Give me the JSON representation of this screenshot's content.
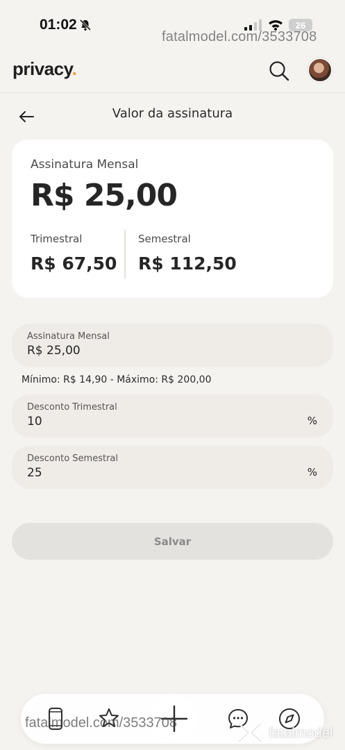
{
  "status_bar": {
    "time": "01:02",
    "battery": "26"
  },
  "watermark": {
    "top": "fatalmodel.com/3533708",
    "bottom": "fatalmodel.com/3533708",
    "brand": "fatalmodel"
  },
  "header": {
    "logo": "privacy",
    "logo_dot": "."
  },
  "page": {
    "title": "Valor da assinatura"
  },
  "summary": {
    "monthly_label": "Assinatura Mensal",
    "monthly_price": "R$ 25,00",
    "quarterly_label": "Trimestral",
    "quarterly_price": "R$ 67,50",
    "semiannual_label": "Semestral",
    "semiannual_price": "R$ 112,50"
  },
  "form": {
    "monthly": {
      "label": "Assinatura Mensal",
      "value": "R$ 25,00"
    },
    "hint": "Mínimo: R$ 14,90 - Máximo: R$ 200,00",
    "quarterly_discount": {
      "label": "Desconto Trimestral",
      "value": "10",
      "suffix": "%"
    },
    "semiannual_discount": {
      "label": "Desconto Semestral",
      "value": "25",
      "suffix": "%"
    },
    "save_label": "Salvar"
  },
  "colors": {
    "accent": "#f29a3a",
    "background": "#f5f3f0",
    "field": "#efebe6"
  },
  "icons": [
    "bell-slash-icon",
    "signal-icon",
    "wifi-icon",
    "search-icon",
    "back-arrow-icon",
    "phone-icon",
    "star-icon",
    "plus-icon",
    "chat-icon",
    "compass-icon"
  ]
}
